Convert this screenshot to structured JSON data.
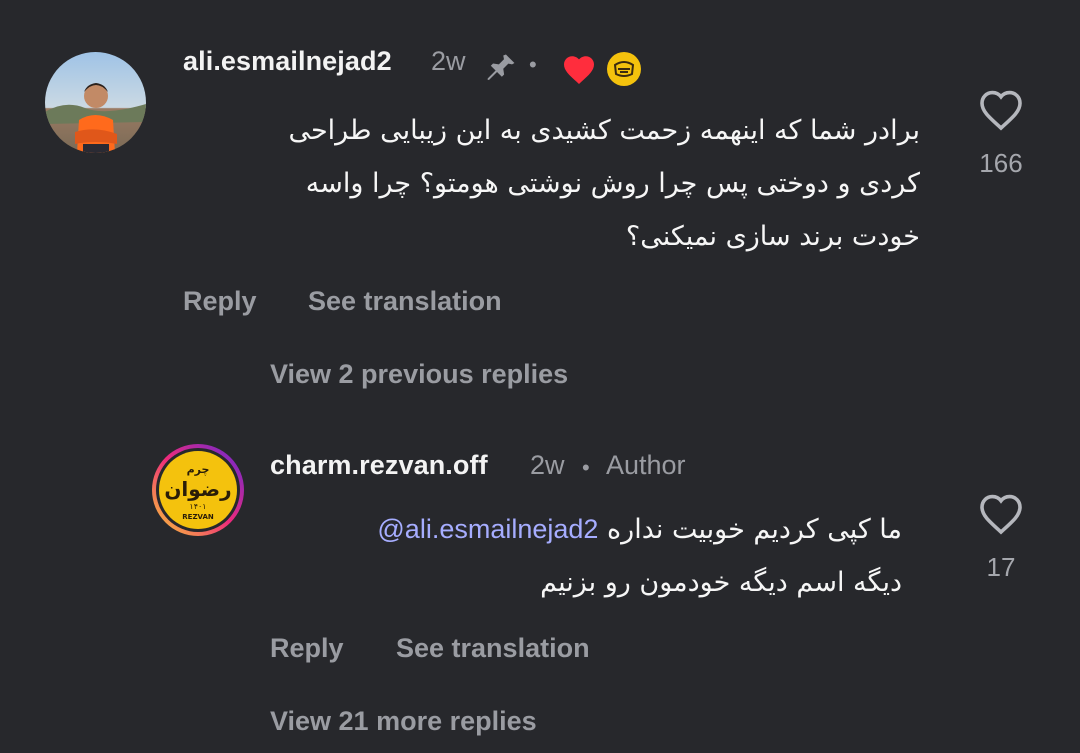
{
  "comments": [
    {
      "username": "ali.esmailnejad2",
      "time": "2w",
      "text_lines": [
        "برادر شما که اینهمه زحمت کشیدی به این زیبایی طراحی",
        "کردی و دوختی پس چرا روش نوشتی هومتو؟ چرا واسه",
        "خودت برند سازی نمیکنی؟"
      ],
      "likes": "166",
      "reply_label": "Reply",
      "translate_label": "See translation",
      "icons": [
        "pin-icon",
        "heart-icon",
        "author-avatar-icon"
      ]
    }
  ],
  "view_previous_label": "View 2 previous replies",
  "reply": {
    "username": "charm.rezvan.off",
    "time": "2w",
    "author_tag": "Author",
    "mention": "@ali.esmailnejad2",
    "text_line1": "ما کپی کردیم خوبیت نداره",
    "text_line2": "دیگه اسم دیگه خودمون رو بزنیم",
    "likes": "17",
    "reply_label": "Reply",
    "translate_label": "See translation"
  },
  "view_more_label": "View 21 more replies",
  "colors": {
    "background": "#27282c",
    "muted": "#9a9ca2",
    "mention": "#a6adff",
    "liked_heart": "#ff2d3d",
    "brand_yellow": "#f4c20d"
  },
  "brand_logo": {
    "line1": "چرم",
    "line2": "رضوان",
    "line3": "۱۴۰۱",
    "line4": "REZVAN"
  }
}
